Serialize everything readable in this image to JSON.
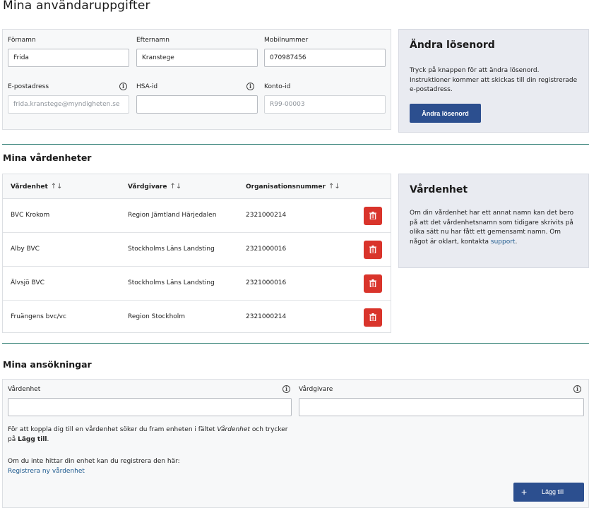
{
  "page": {
    "title": "Mina användaruppgifter"
  },
  "user": {
    "first_name": {
      "label": "Förnamn",
      "value": "Frida"
    },
    "last_name": {
      "label": "Efternamn",
      "value": "Kranstege"
    },
    "mobile": {
      "label": "Mobilnummer",
      "value": "070987456"
    },
    "email": {
      "label": "E-postadress",
      "value": "frida.kranstege@myndigheten.se"
    },
    "hsa_id": {
      "label": "HSA-id",
      "value": ""
    },
    "account_id": {
      "label": "Konto-id",
      "value": "R99-00003"
    }
  },
  "password_panel": {
    "title": "Ändra lösenord",
    "text": "Tryck på knappen för att ändra lösenord. Instruktioner kommer att skickas till din registrerade e-postadress.",
    "button": "Ändra lösenord"
  },
  "units_section": {
    "title": "Mina vårdenheter",
    "columns": [
      "Vårdenhet",
      "Vårdgivare",
      "Organisationsnummer"
    ],
    "rows": [
      {
        "unit": "BVC Krokom",
        "provider": "Region Jämtland Härjedalen",
        "org": "2321000214"
      },
      {
        "unit": "Alby BVC",
        "provider": "Stockholms Läns Landsting",
        "org": "2321000016"
      },
      {
        "unit": "Älvsjö BVC",
        "provider": "Stockholms Läns Landsting",
        "org": "2321000016"
      },
      {
        "unit": "Fruängens bvc/vc",
        "provider": "Region Stockholm",
        "org": "2321000214"
      }
    ]
  },
  "unit_panel": {
    "title": "Vårdenhet",
    "text": "Om din vårdenhet har ett annat namn kan det bero på att det vårdenhetsnamn som tidigare skrivits på olika sätt nu har fått ett gemensamt namn. Om något är oklart, kontakta",
    "link": "support",
    "end": "."
  },
  "applications": {
    "title": "Mina ansökningar",
    "unit_label": "Vårdenhet",
    "provider_label": "Vårdgivare",
    "instruction_1": "För att koppla dig till en vårdenhet söker du fram enheten i fältet",
    "instruction_em": "Vårdenhet",
    "instruction_2": "och trycker på",
    "instruction_bold": "Lägg till",
    "instruction_end": ".",
    "not_found": "Om du inte hittar din enhet kan du registrera den här:",
    "register_link": "Registrera ny vårdenhet",
    "add_button": "Lägg till"
  },
  "colors": {
    "primary": "#2c4f8f",
    "danger": "#d9342b",
    "divider": "#2e7d72",
    "link": "#1e5a8e"
  },
  "icons": {
    "info": "info-icon",
    "sort": "sort-icon",
    "delete": "trash-icon",
    "add": "plus-icon"
  }
}
